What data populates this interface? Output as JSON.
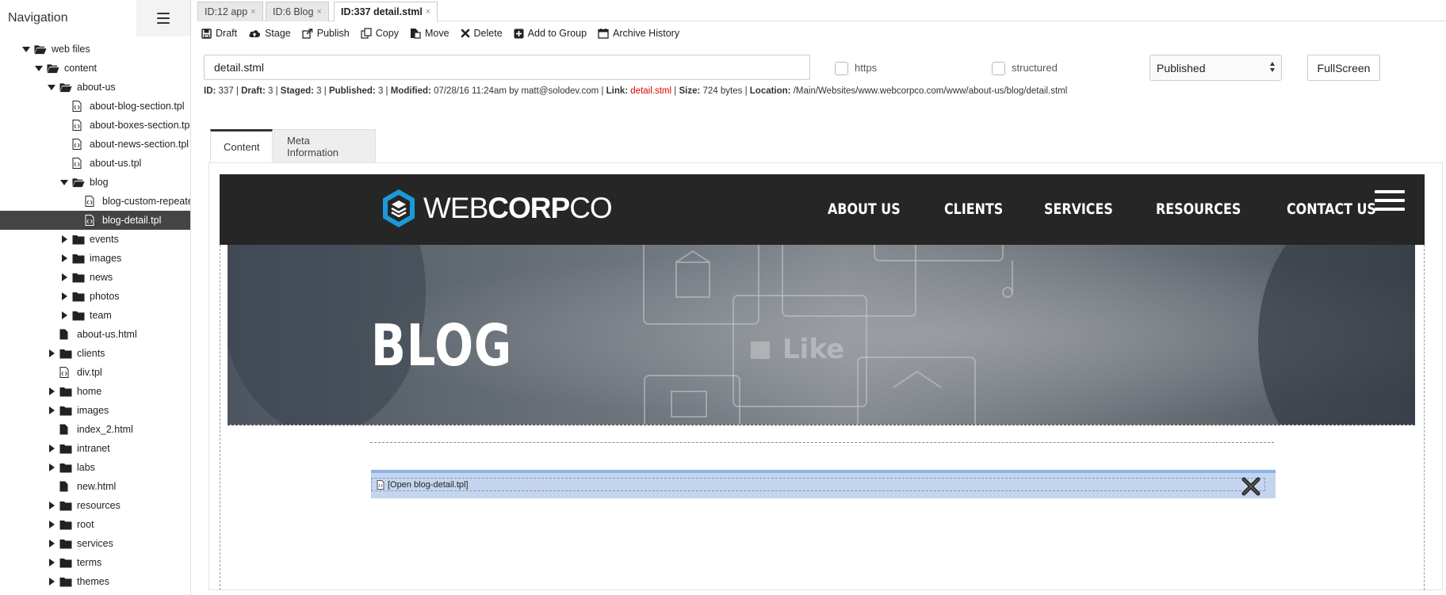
{
  "sidebar": {
    "title": "Navigation",
    "tree": [
      {
        "label": "web files",
        "type": "folder-open",
        "level": 0,
        "caret": "down"
      },
      {
        "label": "content",
        "type": "folder-open",
        "level": 1,
        "caret": "down"
      },
      {
        "label": "about-us",
        "type": "folder-open",
        "level": 2,
        "caret": "down"
      },
      {
        "label": "about-blog-section.tpl",
        "type": "tpl",
        "level": 3,
        "caret": "none"
      },
      {
        "label": "about-boxes-section.tpl",
        "type": "tpl",
        "level": 3,
        "caret": "none"
      },
      {
        "label": "about-news-section.tpl",
        "type": "tpl",
        "level": 3,
        "caret": "none"
      },
      {
        "label": "about-us.tpl",
        "type": "tpl",
        "level": 3,
        "caret": "none"
      },
      {
        "label": "blog",
        "type": "folder-open",
        "level": 3,
        "caret": "down"
      },
      {
        "label": "blog-custom-repeater",
        "type": "tpl",
        "level": 4,
        "caret": "none"
      },
      {
        "label": "blog-detail.tpl",
        "type": "tpl",
        "level": 4,
        "caret": "none",
        "selected": true
      },
      {
        "label": "events",
        "type": "folder",
        "level": 3,
        "caret": "right"
      },
      {
        "label": "images",
        "type": "folder",
        "level": 3,
        "caret": "right"
      },
      {
        "label": "news",
        "type": "folder",
        "level": 3,
        "caret": "right"
      },
      {
        "label": "photos",
        "type": "folder",
        "level": 3,
        "caret": "right"
      },
      {
        "label": "team",
        "type": "folder",
        "level": 3,
        "caret": "right"
      },
      {
        "label": "about-us.html",
        "type": "file",
        "level": 2,
        "caret": "none"
      },
      {
        "label": "clients",
        "type": "folder",
        "level": 2,
        "caret": "right"
      },
      {
        "label": "div.tpl",
        "type": "tpl",
        "level": 2,
        "caret": "none"
      },
      {
        "label": "home",
        "type": "folder",
        "level": 2,
        "caret": "right"
      },
      {
        "label": "images",
        "type": "folder",
        "level": 2,
        "caret": "right"
      },
      {
        "label": "index_2.html",
        "type": "file",
        "level": 2,
        "caret": "none"
      },
      {
        "label": "intranet",
        "type": "folder",
        "level": 2,
        "caret": "right"
      },
      {
        "label": "labs",
        "type": "folder",
        "level": 2,
        "caret": "right"
      },
      {
        "label": "new.html",
        "type": "file",
        "level": 2,
        "caret": "none"
      },
      {
        "label": "resources",
        "type": "folder",
        "level": 2,
        "caret": "right"
      },
      {
        "label": "root",
        "type": "folder",
        "level": 2,
        "caret": "right"
      },
      {
        "label": "services",
        "type": "folder",
        "level": 2,
        "caret": "right"
      },
      {
        "label": "terms",
        "type": "folder",
        "level": 2,
        "caret": "right"
      },
      {
        "label": "themes",
        "type": "folder",
        "level": 2,
        "caret": "right"
      }
    ]
  },
  "tabs": [
    {
      "label": "ID:12 app",
      "close": "×"
    },
    {
      "label": "ID:6 Blog",
      "close": "×"
    },
    {
      "label": "ID:337 detail.stml",
      "close": "×",
      "active": true
    }
  ],
  "toolbar": {
    "draft": "Draft",
    "stage": "Stage",
    "publish": "Publish",
    "copy": "Copy",
    "move": "Move",
    "delete": "Delete",
    "add_to_group": "Add to Group",
    "archive_history": "Archive History"
  },
  "fields": {
    "filename": "detail.stml",
    "https_label": "https",
    "structured_label": "structured",
    "status": "Published",
    "fullscreen": "FullScreen"
  },
  "info": {
    "id_label": "ID:",
    "id": "337",
    "draft_label": "Draft:",
    "draft": "3",
    "staged_label": "Staged:",
    "staged": "3",
    "published_label": "Published:",
    "published": "3",
    "modified_label": "Modified:",
    "modified": "07/28/16 11:24am by matt@solodev.com",
    "link_label": "Link:",
    "link": "detail.stml",
    "size_label": "Size:",
    "size": "724 bytes",
    "location_label": "Location:",
    "location": "/Main/Websites/www.webcorpco.com/www/about-us/blog/detail.stml"
  },
  "content_tabs": {
    "content": "Content",
    "meta": "Meta Information"
  },
  "preview": {
    "logo_light": "WEB",
    "logo_bold": "CORP",
    "logo_tail": "CO",
    "menu": [
      "ABOUT US",
      "CLIENTS",
      "SERVICES",
      "RESOURCES",
      "CONTACT US"
    ],
    "hero_title": "BLOG",
    "include_label": "[Open blog-detail.tpl]"
  },
  "colors": {
    "site_nav_bg": "#262626",
    "logo_blue": "#1a9ad6",
    "link_red": "#dd0000",
    "include_bar": "#c4d5ed"
  }
}
